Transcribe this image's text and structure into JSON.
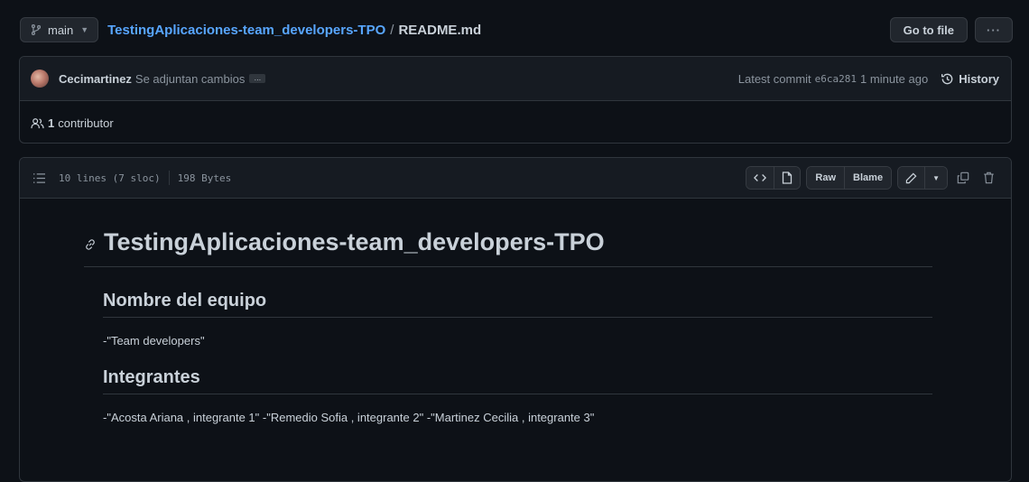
{
  "topbar": {
    "branch": "main",
    "repo": "TestingAplicaciones-team_developers-TPO",
    "separator": "/",
    "file": "README.md",
    "go_to_file": "Go to file",
    "more": "···"
  },
  "commit": {
    "author": "Cecimartinez",
    "message": "Se adjuntan cambios",
    "ellipsis": "…",
    "latest_label": "Latest commit",
    "sha": "e6ca281",
    "time": "1 minute ago",
    "history": "History"
  },
  "contributors": {
    "count": "1",
    "label": "contributor"
  },
  "file_header": {
    "lines": "10 lines (7 sloc)",
    "size": "198 Bytes",
    "raw": "Raw",
    "blame": "Blame"
  },
  "readme": {
    "title": "TestingAplicaciones-team_developers-TPO",
    "section1_heading": "Nombre del equipo",
    "section1_text": "-\"Team developers\"",
    "section2_heading": "Integrantes",
    "section2_text": "-\"Acosta Ariana , integrante 1\" -\"Remedio Sofia , integrante 2\" -\"Martinez Cecilia , integrante 3\""
  },
  "colors": {
    "background": "#0d1117",
    "panel": "#161b22",
    "border": "#30363d",
    "link": "#58a6ff",
    "muted": "#8b949e",
    "text": "#c9d1d9"
  }
}
